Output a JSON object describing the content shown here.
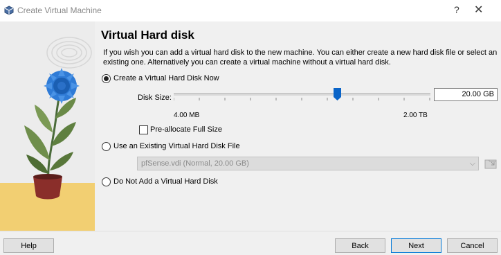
{
  "window": {
    "title": "Create Virtual Machine",
    "help_symbol": "?",
    "close_symbol": "✕"
  },
  "page": {
    "heading": "Virtual Hard disk",
    "description": "If you wish you can add a virtual hard disk to the new machine. You can either create a new hard disk file or select an existing one. Alternatively you can create a virtual machine without a virtual hard disk."
  },
  "options": {
    "create_now": {
      "label": "Create a Virtual Hard Disk Now",
      "selected": true
    },
    "use_existing": {
      "label": "Use an Existing Virtual Hard Disk File",
      "selected": false
    },
    "do_not_add": {
      "label": "Do Not Add a Virtual Hard Disk",
      "selected": false
    }
  },
  "disk_size": {
    "label": "Disk Size:",
    "value": "20.00 GB",
    "min_label": "4.00 MB",
    "max_label": "2.00 TB"
  },
  "preallocate": {
    "label": "Pre-allocate Full Size",
    "checked": false
  },
  "existing_file": {
    "selected": "pfSense.vdi (Normal, 20.00 GB)"
  },
  "footer": {
    "help": "Help",
    "back": "Back",
    "next": "Next",
    "cancel": "Cancel"
  },
  "colors": {
    "accent": "#0a64c8",
    "illustration_bg": "#ececec",
    "floor": "#f2cf72"
  }
}
